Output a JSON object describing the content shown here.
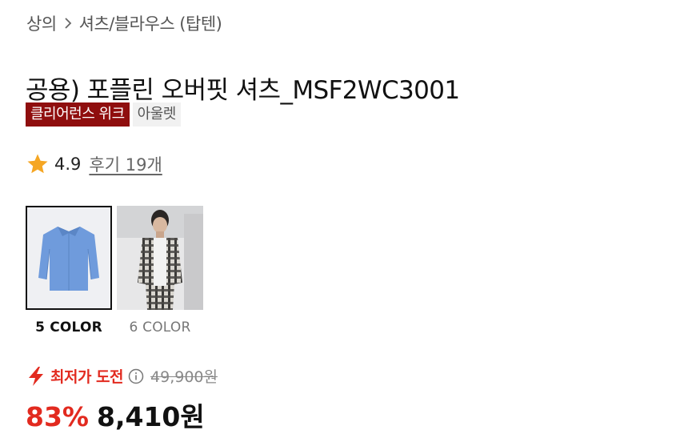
{
  "breadcrumb": {
    "items": [
      "상의",
      "셔츠/블라우스 (탑텐)"
    ],
    "separator_icon": "chevron-right-icon"
  },
  "product": {
    "title": "공용) 포플린 오버핏 셔츠_MSF2WC3001",
    "badges": [
      "클리어런스 위크",
      "아울렛"
    ]
  },
  "rating": {
    "icon": "star-icon",
    "score": "4.9",
    "reviews_label": "후기 19개"
  },
  "color_options": [
    {
      "label": "5 COLOR",
      "selected": true
    },
    {
      "label": "6 COLOR",
      "selected": false
    }
  ],
  "deal": {
    "icon": "lightning-icon",
    "label": "최저가 도전",
    "info_icon": "info-icon",
    "original_price": "49,900원"
  },
  "price": {
    "discount": "83%",
    "amount": "8,410원"
  },
  "colors": {
    "accent_red": "#e22a1f",
    "badge_dark_red": "#8f0e0e",
    "star": "#f5a623"
  }
}
